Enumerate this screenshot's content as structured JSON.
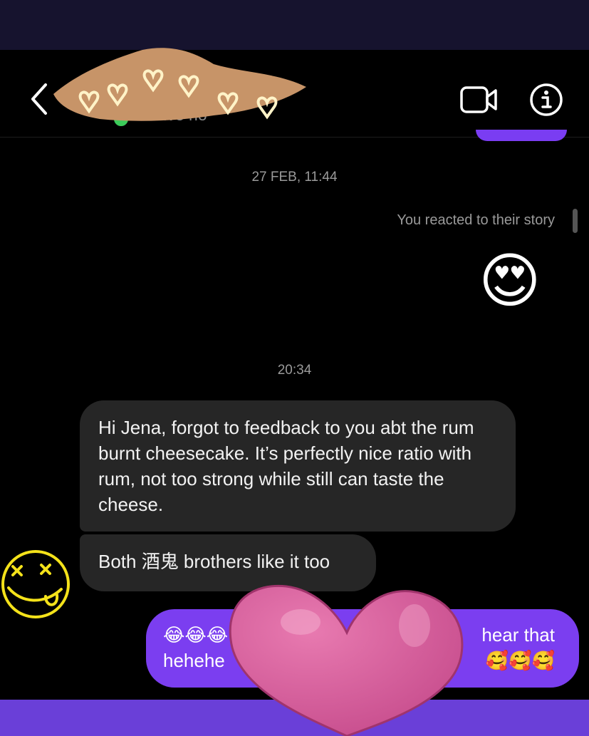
{
  "header": {
    "status_text": "Active no",
    "back_icon": "chevron-left-icon",
    "video_icon": "video-camera-icon",
    "info_icon": "info-icon"
  },
  "thread": {
    "timestamp_1": "27 FEB, 11:44",
    "story_reaction_label": "You reacted to their story",
    "story_reaction_emoji": "😍",
    "timestamp_2": "20:34",
    "incoming_1": "Hi Jena, forgot to feedback to you abt the rum burnt cheesecake. It’s perfectly nice ratio with rum, not too strong while still can taste the cheese.",
    "incoming_2": "Both 酒鬼 brothers like it too",
    "outgoing_visible_left": "😂😂😂 hehehe",
    "outgoing_visible_right_1": "hear that",
    "outgoing_visible_right_2": "🥰🥰🥰"
  },
  "colors": {
    "background": "#000000",
    "incoming_bubble": "#262626",
    "outgoing_bubble": "#7b3ef0",
    "online_dot": "#3ccb5a"
  }
}
